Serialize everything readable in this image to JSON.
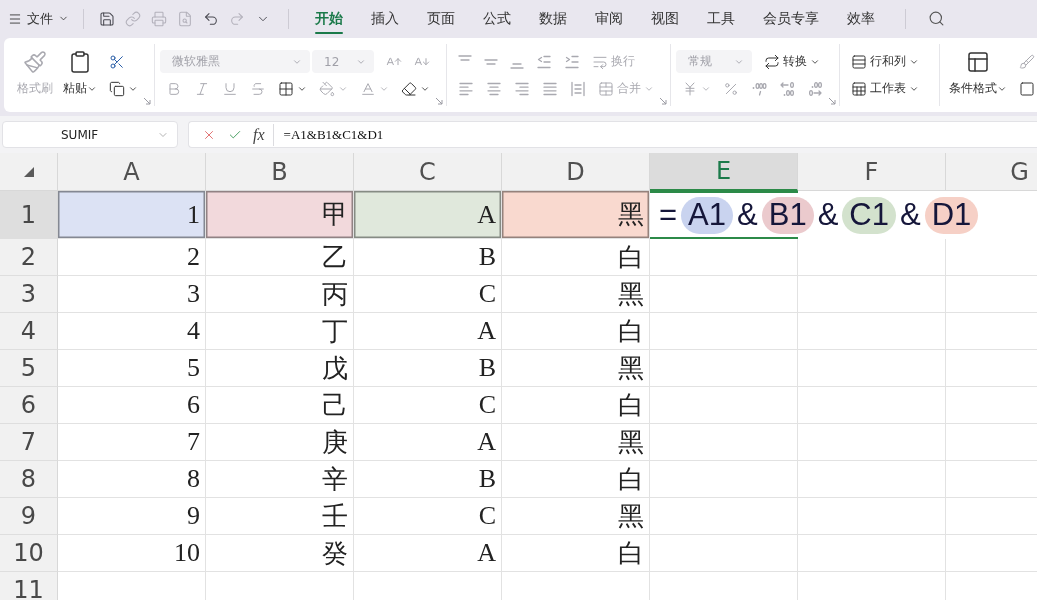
{
  "file_menu": {
    "label": "文件"
  },
  "quick_access": [
    {
      "kind": "save",
      "disabled": false
    },
    {
      "kind": "link",
      "disabled": true
    },
    {
      "kind": "print",
      "disabled": true
    },
    {
      "kind": "print-preview",
      "disabled": true
    },
    {
      "kind": "undo",
      "disabled": false
    },
    {
      "kind": "redo",
      "disabled": true
    },
    {
      "kind": "more",
      "disabled": false
    }
  ],
  "tabs": [
    {
      "label": "开始",
      "selected": true
    },
    {
      "label": "插入",
      "selected": false
    },
    {
      "label": "页面",
      "selected": false
    },
    {
      "label": "公式",
      "selected": false
    },
    {
      "label": "数据",
      "selected": false
    },
    {
      "label": "审阅",
      "selected": false
    },
    {
      "label": "视图",
      "selected": false
    },
    {
      "label": "工具",
      "selected": false
    },
    {
      "label": "会员专享",
      "selected": false
    },
    {
      "label": "效率",
      "selected": false
    }
  ],
  "ribbon": [
    {
      "kind": "clipboard",
      "items": [
        {
          "kind": "format-painter",
          "label": "格式刷",
          "disabled": true
        },
        {
          "kind": "paste",
          "label": "粘贴",
          "disabled": false
        },
        {
          "kind": "cut",
          "disabled": false
        },
        {
          "kind": "copy",
          "disabled": false
        }
      ]
    },
    {
      "kind": "font",
      "font_name": "微软雅黑",
      "font_size": "12",
      "fields_disabled": true,
      "items": [
        {
          "kind": "grow",
          "disabled": true
        },
        {
          "kind": "shrink",
          "disabled": true
        },
        {
          "kind": "bold",
          "disabled": true
        },
        {
          "kind": "italic",
          "disabled": true
        },
        {
          "kind": "underline",
          "disabled": true
        },
        {
          "kind": "strikethrough",
          "disabled": true
        },
        {
          "kind": "borders",
          "disabled": false
        },
        {
          "kind": "fill-color",
          "disabled": true
        },
        {
          "kind": "font-color",
          "disabled": true
        },
        {
          "kind": "clear",
          "disabled": false
        }
      ]
    },
    {
      "kind": "alignment",
      "items": [
        {
          "kind": "align-top",
          "disabled": true
        },
        {
          "kind": "align-middle",
          "disabled": true
        },
        {
          "kind": "align-bottom",
          "disabled": true
        },
        {
          "kind": "outdent",
          "disabled": true
        },
        {
          "kind": "indent",
          "disabled": true
        },
        {
          "kind": "wrap",
          "label": "换行",
          "disabled": true
        },
        {
          "kind": "align-left",
          "disabled": true
        },
        {
          "kind": "align-center",
          "disabled": true
        },
        {
          "kind": "align-right",
          "disabled": true
        },
        {
          "kind": "justify",
          "disabled": true
        },
        {
          "kind": "distributed",
          "disabled": true
        },
        {
          "kind": "merge",
          "label": "合并",
          "disabled": true
        }
      ]
    },
    {
      "kind": "number",
      "format": "常规",
      "format_disabled": true,
      "items": [
        {
          "kind": "convert",
          "label": "转换",
          "disabled": false
        },
        {
          "kind": "currency",
          "disabled": true
        },
        {
          "kind": "percent",
          "disabled": true
        },
        {
          "kind": "thousands",
          "disabled": true
        },
        {
          "kind": "increase-decimal",
          "disabled": true
        },
        {
          "kind": "decrease-decimal",
          "disabled": true
        }
      ]
    },
    {
      "kind": "rows-sheets",
      "items": [
        {
          "kind": "rows-columns",
          "label": "行和列",
          "disabled": false
        },
        {
          "kind": "worksheet",
          "label": "工作表",
          "disabled": false
        }
      ]
    },
    {
      "kind": "styles",
      "items": [
        {
          "kind": "conditional-format",
          "label": "条件格式",
          "disabled": false
        },
        {
          "kind": "table-style",
          "disabled": true
        },
        {
          "kind": "cell-style",
          "disabled": false
        }
      ]
    }
  ],
  "formula_bar": {
    "name_box": "SUMIF",
    "function_label": "fx",
    "formula": "=A1&B1&C1&D1"
  },
  "columns": [
    {
      "label": "A",
      "selected": false
    },
    {
      "label": "B",
      "selected": false
    },
    {
      "label": "C",
      "selected": false
    },
    {
      "label": "D",
      "selected": false
    },
    {
      "label": "E",
      "selected": true
    },
    {
      "label": "F",
      "selected": false
    },
    {
      "label": "G",
      "selected": false
    }
  ],
  "rows": [
    {
      "label": "1",
      "selected": true,
      "cells": [
        {
          "text": "1",
          "color": "#dce2f4"
        },
        {
          "text": "甲",
          "color": "#f2d9dc"
        },
        {
          "text": "A",
          "color": "#e0e8dc"
        },
        {
          "text": "黑",
          "color": "#f9d9cf"
        }
      ]
    },
    {
      "label": "2",
      "selected": false,
      "cells": [
        {
          "text": "2"
        },
        {
          "text": "乙"
        },
        {
          "text": "B"
        },
        {
          "text": "白"
        }
      ]
    },
    {
      "label": "3",
      "selected": false,
      "cells": [
        {
          "text": "3"
        },
        {
          "text": "丙"
        },
        {
          "text": "C"
        },
        {
          "text": "黑"
        }
      ]
    },
    {
      "label": "4",
      "selected": false,
      "cells": [
        {
          "text": "4"
        },
        {
          "text": "丁"
        },
        {
          "text": "A"
        },
        {
          "text": "白"
        }
      ]
    },
    {
      "label": "5",
      "selected": false,
      "cells": [
        {
          "text": "5"
        },
        {
          "text": "戊"
        },
        {
          "text": "B"
        },
        {
          "text": "黑"
        }
      ]
    },
    {
      "label": "6",
      "selected": false,
      "cells": [
        {
          "text": "6"
        },
        {
          "text": "己"
        },
        {
          "text": "C"
        },
        {
          "text": "白"
        }
      ]
    },
    {
      "label": "7",
      "selected": false,
      "cells": [
        {
          "text": "7"
        },
        {
          "text": "庚"
        },
        {
          "text": "A"
        },
        {
          "text": "黑"
        }
      ]
    },
    {
      "label": "8",
      "selected": false,
      "cells": [
        {
          "text": "8"
        },
        {
          "text": "辛"
        },
        {
          "text": "B"
        },
        {
          "text": "白"
        }
      ]
    },
    {
      "label": "9",
      "selected": false,
      "cells": [
        {
          "text": "9"
        },
        {
          "text": "壬"
        },
        {
          "text": "C"
        },
        {
          "text": "黑"
        }
      ]
    },
    {
      "label": "10",
      "selected": false,
      "cells": [
        {
          "text": "10"
        },
        {
          "text": "癸"
        },
        {
          "text": "A"
        },
        {
          "text": "白"
        }
      ]
    },
    {
      "label": "11",
      "selected": false
    }
  ],
  "cell_editor": {
    "tokens": [
      {
        "kind": "operator",
        "text": "="
      },
      {
        "kind": "ref",
        "text": "A1",
        "color": "#c9d3ef"
      },
      {
        "kind": "operator",
        "text": "&"
      },
      {
        "kind": "ref",
        "text": "B1",
        "color": "#ebcacd"
      },
      {
        "kind": "operator",
        "text": "&"
      },
      {
        "kind": "ref",
        "text": "C1",
        "color": "#d3e2cd"
      },
      {
        "kind": "operator",
        "text": "&"
      },
      {
        "kind": "ref",
        "text": "D1",
        "color": "#f6d0c6"
      }
    ]
  }
}
